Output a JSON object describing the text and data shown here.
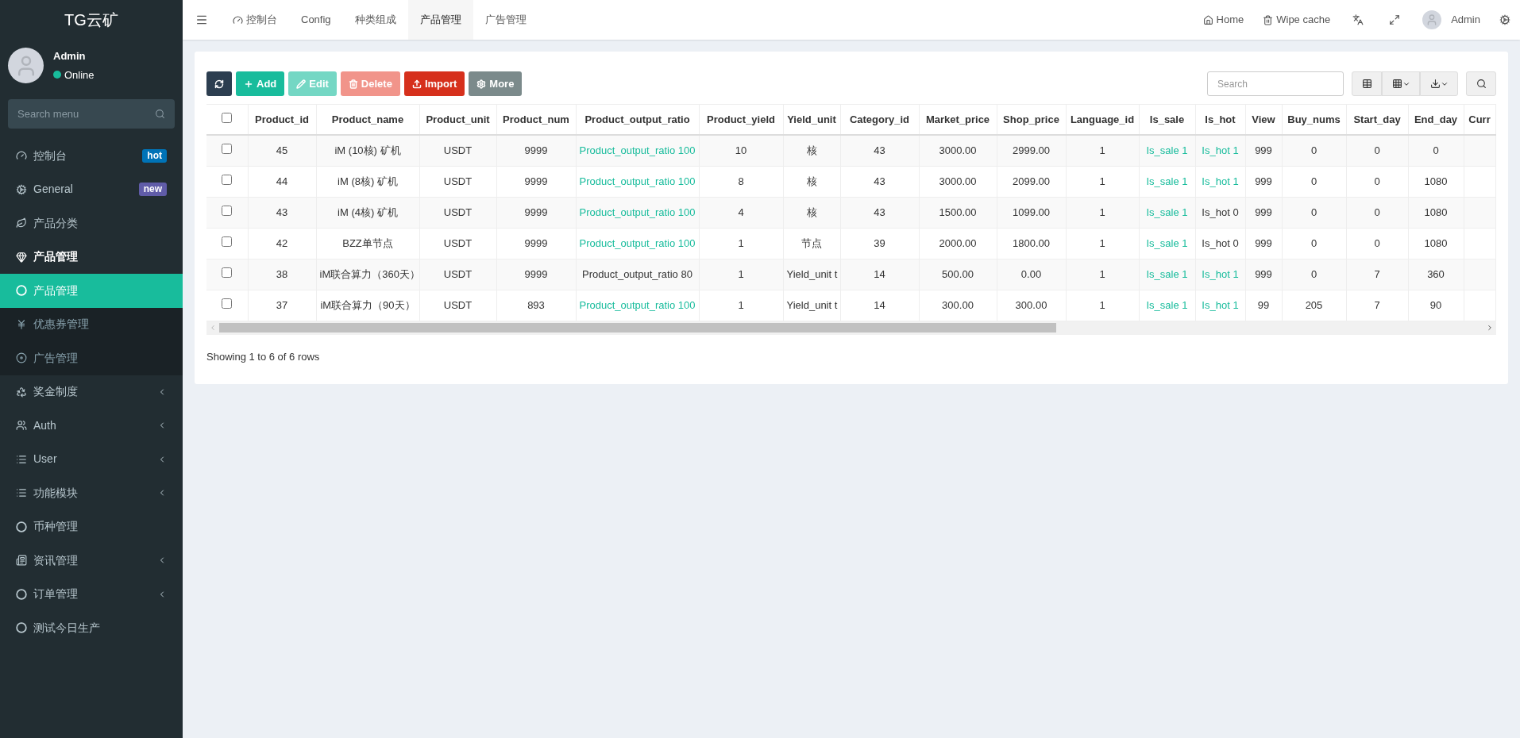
{
  "brand": "TG云矿",
  "user": {
    "name": "Admin",
    "status": "Online"
  },
  "sidebar_search": {
    "placeholder": "Search menu"
  },
  "sidebar": {
    "items": [
      {
        "label": "控制台",
        "badge": {
          "text": "hot",
          "color": "#0073b7"
        },
        "selected": false,
        "has_children": false
      },
      {
        "label": "General",
        "badge": {
          "text": "new",
          "color": "#605ca8"
        },
        "selected": false,
        "has_children": false
      },
      {
        "label": "产品分类",
        "selected": false,
        "has_children": false
      },
      {
        "label": "产品管理",
        "selected": false,
        "has_children": false,
        "expanded": true,
        "children": [
          {
            "label": "产品管理",
            "selected": true
          },
          {
            "label": "优惠券管理",
            "selected": false
          },
          {
            "label": "广告管理",
            "selected": false
          }
        ]
      },
      {
        "label": "奖金制度",
        "selected": false,
        "has_children": true
      },
      {
        "label": "Auth",
        "selected": false,
        "has_children": true
      },
      {
        "label": "User",
        "selected": false,
        "has_children": true
      },
      {
        "label": "功能模块",
        "selected": false,
        "has_children": true
      },
      {
        "label": "币种管理",
        "selected": false,
        "has_children": false
      },
      {
        "label": "资讯管理",
        "selected": false,
        "has_children": true
      },
      {
        "label": "订单管理",
        "selected": false,
        "has_children": true
      },
      {
        "label": "测试今日生产",
        "selected": false,
        "has_children": false
      }
    ]
  },
  "top_tabs": [
    {
      "label": "控制台",
      "selected": false
    },
    {
      "label": "Config",
      "selected": false
    },
    {
      "label": "种类组成",
      "selected": false
    },
    {
      "label": "产品管理",
      "selected": true
    },
    {
      "label": "广告管理",
      "selected": false
    }
  ],
  "top_right": {
    "home": "Home",
    "wipe_cache": "Wipe cache",
    "user": "Admin"
  },
  "toolbar": [
    {
      "kind": "refresh",
      "disabled": false
    },
    {
      "kind": "add",
      "label": "Add",
      "disabled": false
    },
    {
      "kind": "edit",
      "label": "Edit",
      "disabled": true
    },
    {
      "kind": "delete",
      "label": "Delete",
      "disabled": true
    },
    {
      "kind": "import",
      "label": "Import",
      "disabled": false
    },
    {
      "kind": "more",
      "label": "More",
      "disabled": false
    }
  ],
  "table_search": {
    "placeholder": "Search"
  },
  "table": {
    "select_all_checked": false,
    "columns": [
      "Product_id",
      "Product_name",
      "Product_unit",
      "Product_num",
      "Product_output_ratio",
      "Product_yield",
      "Yield_unit",
      "Category_id",
      "Market_price",
      "Shop_price",
      "Language_id",
      "Is_sale",
      "Is_hot",
      "View",
      "Buy_nums",
      "Start_day",
      "End_day",
      "Curr"
    ],
    "rows": [
      {
        "checked": false,
        "cells": [
          "45",
          "iM (10核) 矿机",
          "USDT",
          "9999",
          {
            "text": "Product_output_ratio 100",
            "link": true
          },
          "10",
          "核",
          "43",
          "3000.00",
          "2999.00",
          "1",
          {
            "text": "Is_sale 1",
            "link": true
          },
          {
            "text": "Is_hot 1",
            "link": true
          },
          "999",
          "0",
          "0",
          "0"
        ]
      },
      {
        "checked": false,
        "cells": [
          "44",
          "iM (8核) 矿机",
          "USDT",
          "9999",
          {
            "text": "Product_output_ratio 100",
            "link": true
          },
          "8",
          "核",
          "43",
          "3000.00",
          "2099.00",
          "1",
          {
            "text": "Is_sale 1",
            "link": true
          },
          {
            "text": "Is_hot 1",
            "link": true
          },
          "999",
          "0",
          "0",
          "1080"
        ]
      },
      {
        "checked": false,
        "cells": [
          "43",
          "iM (4核) 矿机",
          "USDT",
          "9999",
          {
            "text": "Product_output_ratio 100",
            "link": true
          },
          "4",
          "核",
          "43",
          "1500.00",
          "1099.00",
          "1",
          {
            "text": "Is_sale 1",
            "link": true
          },
          {
            "text": "Is_hot 0",
            "link": false
          },
          "999",
          "0",
          "0",
          "1080"
        ]
      },
      {
        "checked": false,
        "cells": [
          "42",
          "BZZ单节点",
          "USDT",
          "9999",
          {
            "text": "Product_output_ratio 100",
            "link": true
          },
          "1",
          "节点",
          "39",
          "2000.00",
          "1800.00",
          "1",
          {
            "text": "Is_sale 1",
            "link": true
          },
          {
            "text": "Is_hot 0",
            "link": false
          },
          "999",
          "0",
          "0",
          "1080"
        ]
      },
      {
        "checked": false,
        "cells": [
          "38",
          "iM联合算力（360天）",
          "USDT",
          "9999",
          {
            "text": "Product_output_ratio 80",
            "link": false
          },
          "1",
          "Yield_unit t",
          "14",
          "500.00",
          "0.00",
          "1",
          {
            "text": "Is_sale 1",
            "link": true
          },
          {
            "text": "Is_hot 1",
            "link": true
          },
          "999",
          "0",
          "7",
          "360"
        ]
      },
      {
        "checked": false,
        "cells": [
          "37",
          "iM联合算力（90天）",
          "USDT",
          "893",
          {
            "text": "Product_output_ratio 100",
            "link": true
          },
          "1",
          "Yield_unit t",
          "14",
          "300.00",
          "300.00",
          "1",
          {
            "text": "Is_sale 1",
            "link": true
          },
          {
            "text": "Is_hot 1",
            "link": true
          },
          "99",
          "205",
          "7",
          "90"
        ]
      }
    ]
  },
  "footer_text": "Showing 1 to 6 of 6 rows"
}
